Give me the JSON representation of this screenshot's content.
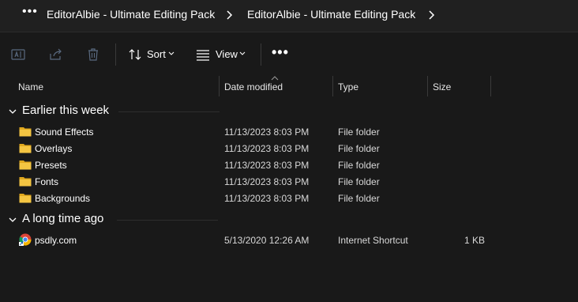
{
  "breadcrumb": {
    "more_label": "•••",
    "items": [
      "EditorAlbie - Ultimate Editing Pack",
      "EditorAlbie - Ultimate Editing Pack"
    ]
  },
  "toolbar": {
    "sort_label": "Sort",
    "view_label": "View",
    "more_label": "•••"
  },
  "columns": {
    "name": "Name",
    "date": "Date modified",
    "type": "Type",
    "size": "Size"
  },
  "groups": [
    {
      "label": "Earlier this week",
      "items": [
        {
          "name": "Sound Effects",
          "date": "11/13/2023 8:03 PM",
          "type": "File folder",
          "size": "",
          "icon": "folder-icon"
        },
        {
          "name": "Overlays",
          "date": "11/13/2023 8:03 PM",
          "type": "File folder",
          "size": "",
          "icon": "folder-icon"
        },
        {
          "name": "Presets",
          "date": "11/13/2023 8:03 PM",
          "type": "File folder",
          "size": "",
          "icon": "folder-icon"
        },
        {
          "name": "Fonts",
          "date": "11/13/2023 8:03 PM",
          "type": "File folder",
          "size": "",
          "icon": "folder-icon"
        },
        {
          "name": "Backgrounds",
          "date": "11/13/2023 8:03 PM",
          "type": "File folder",
          "size": "",
          "icon": "folder-icon"
        }
      ]
    },
    {
      "label": "A long time ago",
      "items": [
        {
          "name": "psdly.com",
          "date": "5/13/2020 12:26 AM",
          "type": "Internet Shortcut",
          "size": "1 KB",
          "icon": "chrome-shortcut-icon"
        }
      ]
    }
  ],
  "colors": {
    "background": "#191919",
    "folder": "#f4c542",
    "text": "#ffffff"
  }
}
